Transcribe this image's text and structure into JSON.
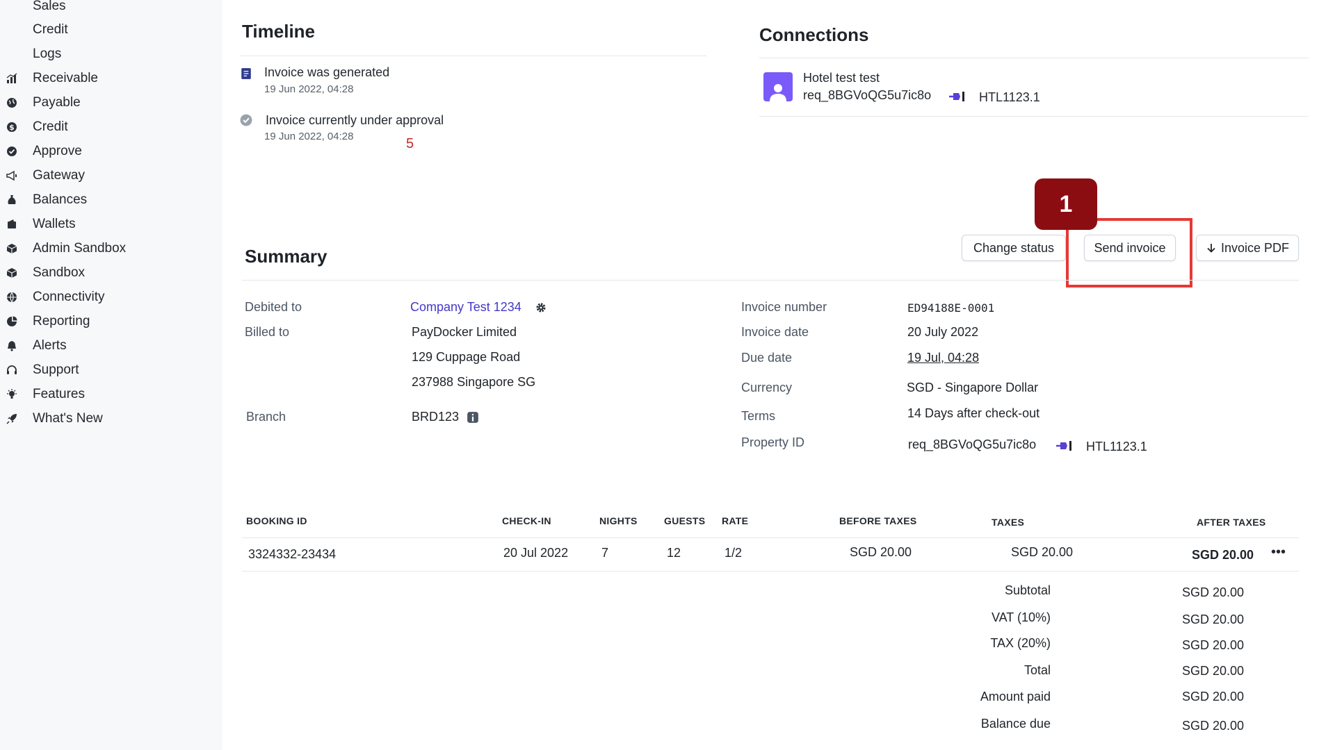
{
  "sidebar": {
    "items": [
      {
        "label": "Sales",
        "icon": "none"
      },
      {
        "label": "Credit",
        "icon": "none"
      },
      {
        "label": "Logs",
        "icon": "none"
      },
      {
        "label": "Receivable",
        "icon": "bar-chart-icon"
      },
      {
        "label": "Payable",
        "icon": "globe-icon"
      },
      {
        "label": "Credit",
        "icon": "dollar-icon"
      },
      {
        "label": "Approve",
        "icon": "check-circle-icon"
      },
      {
        "label": "Gateway",
        "icon": "megaphone-icon"
      },
      {
        "label": "Balances",
        "icon": "money-bag-icon"
      },
      {
        "label": "Wallets",
        "icon": "wallet-icon"
      },
      {
        "label": "Admin Sandbox",
        "icon": "cube-icon"
      },
      {
        "label": "Sandbox",
        "icon": "cube-icon"
      },
      {
        "label": "Connectivity",
        "icon": "globe-icon"
      },
      {
        "label": "Reporting",
        "icon": "pie-chart-icon"
      },
      {
        "label": "Alerts",
        "icon": "bell-icon"
      },
      {
        "label": "Support",
        "icon": "headset-icon"
      },
      {
        "label": "Features",
        "icon": "bulb-icon"
      },
      {
        "label": "What's New",
        "icon": "rocket-icon"
      }
    ]
  },
  "timeline": {
    "title": "Timeline",
    "events": [
      {
        "text": "Invoice was generated",
        "time": "19 Jun 2022, 04:28",
        "icon": "document-icon"
      },
      {
        "text": "Invoice currently under approval",
        "time": "19 Jun 2022, 04:28",
        "icon": "check-circle-icon"
      }
    ],
    "badge": "5"
  },
  "connections": {
    "title": "Connections",
    "name": "Hotel test test",
    "ref": "req_8BGVoQG5u7ic8o",
    "code": "HTL1123.1"
  },
  "step_badge": "1",
  "actions": {
    "change_status": "Change status",
    "send_invoice": "Send invoice",
    "invoice_pdf": "Invoice PDF"
  },
  "summary": {
    "title": "Summary",
    "debited_to_label": "Debited to",
    "debited_to_value": "Company Test 1234",
    "billed_to_label": "Billed to",
    "billed_to_lines": [
      "PayDocker Limited",
      "129 Cuppage Road",
      "237988 Singapore SG"
    ],
    "branch_label": "Branch",
    "branch_value": "BRD123",
    "invoice_number_label": "Invoice number",
    "invoice_number_value": "ED94188E-0001",
    "invoice_date_label": "Invoice date",
    "invoice_date_value": "20 July 2022",
    "due_date_label": "Due date",
    "due_date_value": "19 Jul, 04:28",
    "currency_label": "Currency",
    "currency_value": "SGD - Singapore Dollar",
    "terms_label": "Terms",
    "terms_value": "14 Days after check-out",
    "property_id_label": "Property ID",
    "property_id_ref": "req_8BGVoQG5u7ic8o",
    "property_id_code": "HTL1123.1"
  },
  "table": {
    "headers": {
      "booking_id": "BOOKING ID",
      "check_in": "CHECK-IN",
      "nights": "NIGHTS",
      "guests": "GUESTS",
      "rate": "RATE",
      "before_taxes": "BEFORE TAXES",
      "taxes": "TAXES",
      "after_taxes": "AFTER TAXES"
    },
    "rows": [
      {
        "booking_id": "3324332-23434",
        "check_in": "20 Jul 2022",
        "nights": "7",
        "guests": "12",
        "rate": "1/2",
        "before_taxes": "SGD 20.00",
        "taxes": "SGD 20.00",
        "after_taxes": "SGD 20.00"
      }
    ]
  },
  "totals": [
    {
      "label": "Subtotal",
      "value": "SGD 20.00"
    },
    {
      "label": "VAT (10%)",
      "value": "SGD 20.00"
    },
    {
      "label": "TAX (20%)",
      "value": "SGD 20.00"
    },
    {
      "label": "Total",
      "value": "SGD 20.00"
    },
    {
      "label": "Amount paid",
      "value": "SGD 20.00"
    },
    {
      "label": "Balance due",
      "value": "SGD 20.00"
    }
  ],
  "colors": {
    "accent": "#4338ca",
    "avatar": "#7a5af8",
    "highlight": "#e53935",
    "step_badge": "#8b0d12",
    "timeline_badge": "#c62828"
  }
}
